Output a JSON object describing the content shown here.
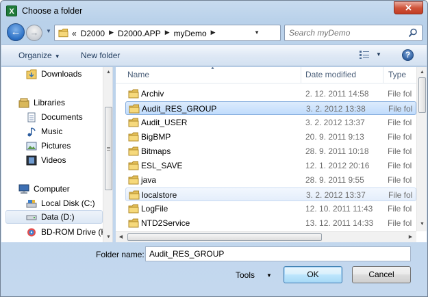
{
  "window": {
    "title": "Choose a folder",
    "app_icon_letter": "X",
    "close_glyph": "✕"
  },
  "address": {
    "overflow": "«",
    "breadcrumbs": [
      "D2000",
      "D2000.APP",
      "myDemo"
    ],
    "search_placeholder": "Search myDemo"
  },
  "toolbar": {
    "organize_label": "Organize",
    "new_folder_label": "New folder",
    "help_label": "?"
  },
  "nav": {
    "items": [
      {
        "label": "Downloads",
        "icon": "downloads-folder-icon"
      },
      {
        "label": "Libraries",
        "icon": "libraries-icon"
      },
      {
        "label": "Documents",
        "icon": "documents-icon"
      },
      {
        "label": "Music",
        "icon": "music-icon"
      },
      {
        "label": "Pictures",
        "icon": "pictures-icon"
      },
      {
        "label": "Videos",
        "icon": "videos-icon"
      },
      {
        "label": "Computer",
        "icon": "computer-icon"
      },
      {
        "label": "Local Disk (C:)",
        "icon": "local-disk-icon"
      },
      {
        "label": "Data (D:)",
        "icon": "drive-icon"
      },
      {
        "label": "BD-ROM Drive (K",
        "icon": "bd-rom-icon"
      }
    ]
  },
  "columns": {
    "name": "Name",
    "date": "Date modified",
    "type": "Type"
  },
  "files": [
    {
      "name": "Archiv",
      "date": "2. 12. 2011 14:58",
      "type": "File fol"
    },
    {
      "name": "Audit_RES_GROUP",
      "date": "3. 2. 2012 13:38",
      "type": "File fol"
    },
    {
      "name": "Audit_USER",
      "date": "3. 2. 2012 13:37",
      "type": "File fol"
    },
    {
      "name": "BigBMP",
      "date": "20. 9. 2011 9:13",
      "type": "File fol"
    },
    {
      "name": "Bitmaps",
      "date": "28. 9. 2011 10:18",
      "type": "File fol"
    },
    {
      "name": "ESL_SAVE",
      "date": "12. 1. 2012 20:16",
      "type": "File fol"
    },
    {
      "name": "java",
      "date": "28. 9. 2011 9:55",
      "type": "File fol"
    },
    {
      "name": "localstore",
      "date": "3. 2. 2012 13:37",
      "type": "File fol"
    },
    {
      "name": "LogFile",
      "date": "12. 10. 2011 11:43",
      "type": "File fol"
    },
    {
      "name": "NTD2Service",
      "date": "13. 12. 2011 14:33",
      "type": "File fol"
    }
  ],
  "footer": {
    "folder_name_label": "Folder name:",
    "folder_name_value": "Audit_RES_GROUP",
    "tools_label": "Tools",
    "ok_label": "OK",
    "cancel_label": "Cancel"
  }
}
